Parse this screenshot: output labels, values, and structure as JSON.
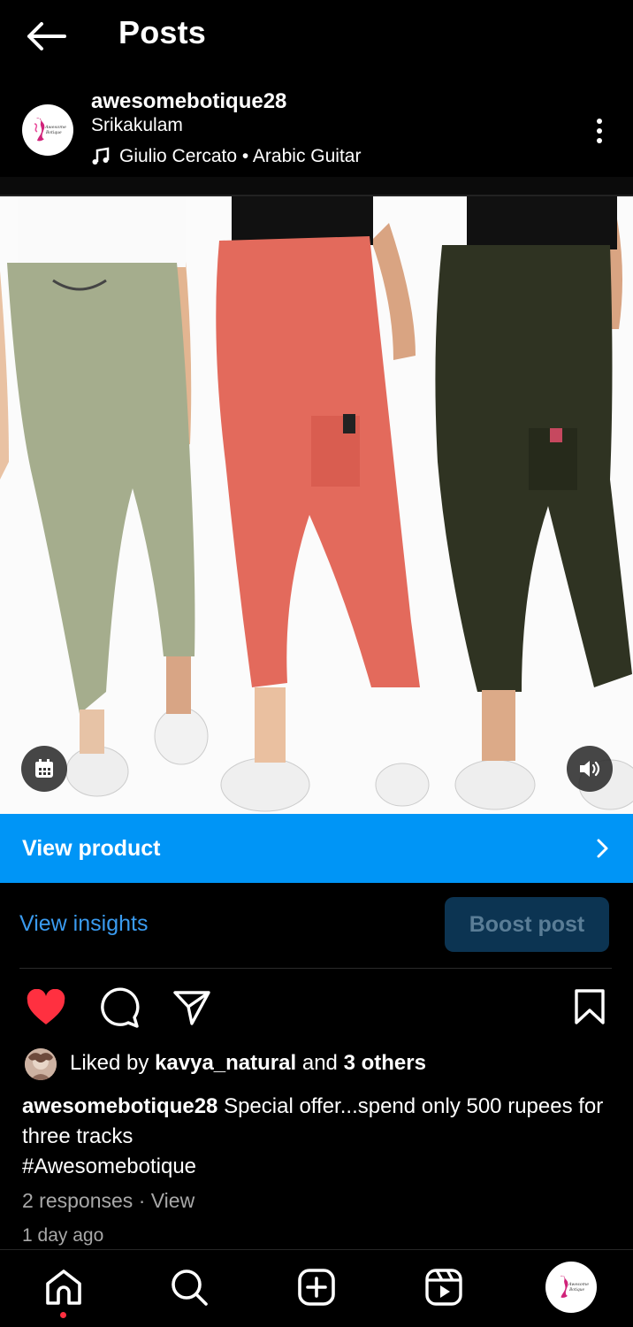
{
  "header": {
    "title": "Posts"
  },
  "post": {
    "username": "awesomebotique28",
    "location": "Srikakulam",
    "music": "Giulio Cercato • Arabic Guitar",
    "view_product_label": "View product",
    "view_insights_label": "View insights",
    "boost_label": "Boost post",
    "likes": {
      "prefix": "Liked by",
      "user": "kavya_natural",
      "middle": "and",
      "others": "3 others"
    },
    "caption": {
      "username": "awesomebotique28",
      "text": "Special offer...spend only 500 rupees for three tracks",
      "hashtag": "#Awesomebotique"
    },
    "responses": "2 responses · View",
    "time_ago": "1 day ago"
  },
  "logo_text": "Awesome Botique",
  "icons": {
    "back": "arrow-left-icon",
    "more": "more-vertical-icon",
    "music": "music-note-icon",
    "calendar": "calendar-icon",
    "volume": "volume-icon",
    "chevron": "chevron-right-icon",
    "like": "heart-filled-icon",
    "comment": "comment-icon",
    "share": "send-icon",
    "save": "bookmark-icon",
    "nav": [
      "home-icon",
      "search-icon",
      "add-post-icon",
      "reels-icon",
      "profile-avatar"
    ]
  },
  "colors": {
    "accent_blue": "#0095f6",
    "link_blue": "#3a9bf0",
    "like_red": "#ff3040",
    "product_colors": [
      "#a5ad8d",
      "#e36a5c",
      "#2f3322"
    ]
  }
}
